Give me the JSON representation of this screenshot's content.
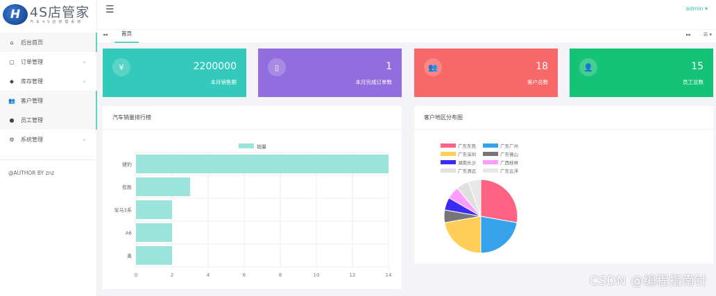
{
  "logo": {
    "title": "4S店管家",
    "subtitle": "汽车4S店管理系统",
    "mark": "H"
  },
  "sidebar": {
    "items": [
      {
        "label": "后台首页",
        "icon": "home-icon",
        "glyph": "⌂",
        "chevron": false
      },
      {
        "label": "订单管理",
        "icon": "clipboard-icon",
        "glyph": "▢",
        "chevron": true
      },
      {
        "label": "库存管理",
        "icon": "cube-icon",
        "glyph": "◆",
        "chevron": true
      },
      {
        "label": "客户管理",
        "icon": "users-icon",
        "glyph": "👥",
        "chevron": false
      },
      {
        "label": "员工管理",
        "icon": "user-icon",
        "glyph": "●",
        "chevron": false
      },
      {
        "label": "系统管理",
        "icon": "gear-icon",
        "glyph": "⚙",
        "chevron": true
      }
    ],
    "chevron": "›",
    "author": "@AUTHOR BY znz"
  },
  "topbar": {
    "menu_glyph": "☰",
    "user": "admin ▾"
  },
  "tabs": {
    "back": "◂◂",
    "home": "首页",
    "forward": "▸▸",
    "more": "☰ ▾"
  },
  "cards": [
    {
      "value": "2200000",
      "label": "本月销售额",
      "glyph": "¥",
      "icon": "yen-icon",
      "color": "#33cabb"
    },
    {
      "value": "1",
      "label": "本月完成订单数",
      "glyph": "▯",
      "icon": "clipboard-icon",
      "color": "#926dde"
    },
    {
      "value": "18",
      "label": "客户总数",
      "glyph": "👥",
      "icon": "users-icon",
      "color": "#f96868"
    },
    {
      "value": "15",
      "label": "员工总数",
      "glyph": "👤",
      "icon": "user-icon",
      "color": "#15c377"
    }
  ],
  "panels": {
    "sales": "汽车销量排行榜",
    "region": "客户地区分布图"
  },
  "chart_data": [
    {
      "type": "bar",
      "orientation": "horizontal",
      "title": "汽车销量排行榜",
      "legend": [
        "销量"
      ],
      "categories": [
        "捷豹",
        "揽胜",
        "宝马3系",
        "A6",
        "奥"
      ],
      "values": [
        14,
        3,
        2,
        2,
        2
      ],
      "xlim": [
        0,
        14
      ],
      "xticks": [
        0,
        2,
        4,
        6,
        8,
        10,
        12,
        14
      ],
      "color": "#9ae4dc"
    },
    {
      "type": "pie",
      "title": "客户地区分布图",
      "labels": [
        "广东东莞",
        "广东广州",
        "广东深圳",
        "广东佛山",
        "湖南长沙",
        "广西桂林",
        "广东清远",
        "广东云浮"
      ],
      "values": [
        5,
        4,
        4,
        1,
        1,
        1,
        1,
        1
      ],
      "colors": [
        "#ff6384",
        "#36a2eb",
        "#ffce56",
        "#76767a",
        "#3a2cf5",
        "#ff9cff",
        "#e0e0e0",
        "#e8e8e8"
      ]
    }
  ],
  "watermark": "CSDN @编程指南针"
}
